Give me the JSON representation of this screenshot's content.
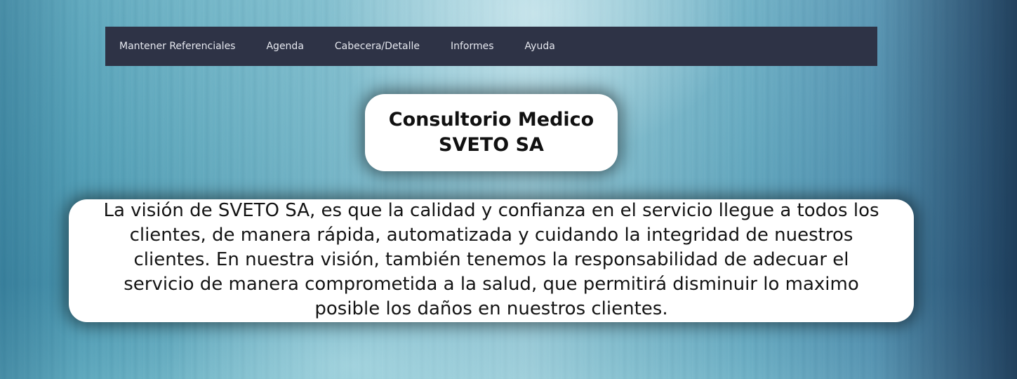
{
  "nav": {
    "items": [
      {
        "label": "Mantener Referenciales"
      },
      {
        "label": "Agenda"
      },
      {
        "label": "Cabecera/Detalle"
      },
      {
        "label": "Informes"
      },
      {
        "label": "Ayuda"
      }
    ]
  },
  "header": {
    "title_line1": "Consultorio Medico",
    "title_line2": "SVETO SA"
  },
  "main": {
    "vision_text": "La visión de SVETO SA, es que la calidad y confianza en el servicio llegue a todos los clientes, de manera rápida, automatizada y cuidando la integridad de nuestros clientes. En nuestra visión, también tenemos la responsabilidad de adecuar el servicio de manera comprometida a la salud, que permitirá disminuir lo maximo posible los daños en nuestros clientes."
  },
  "colors": {
    "nav_background": "#2e3346",
    "nav_text": "#e6e8ef",
    "card_background": "#ffffff",
    "text": "#111111"
  }
}
